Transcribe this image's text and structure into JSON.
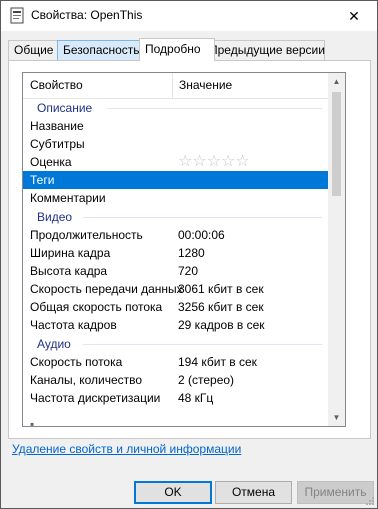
{
  "window": {
    "title": "Свойства: OpenThis",
    "close_glyph": "✕"
  },
  "tabs": [
    "Общие",
    "Безопасность",
    "Подробно",
    "Предыдущие версии"
  ],
  "list": {
    "header": {
      "property": "Свойство",
      "value": "Значение"
    },
    "groups": {
      "description": "Описание",
      "video": "Видео",
      "audio": "Аудио"
    },
    "description_rows": [
      {
        "k": "Название",
        "v": ""
      },
      {
        "k": "Субтитры",
        "v": ""
      },
      {
        "k": "Оценка",
        "v": ""
      },
      {
        "k": "Теги",
        "v": ""
      },
      {
        "k": "Комментарии",
        "v": ""
      }
    ],
    "rating": {
      "stars_total": 5,
      "stars_filled": 0,
      "glyph": "☆☆☆☆☆"
    },
    "video_rows": [
      {
        "k": "Продолжительность",
        "v": "00:00:06"
      },
      {
        "k": "Ширина кадра",
        "v": "1280"
      },
      {
        "k": "Высота кадра",
        "v": "720"
      },
      {
        "k": "Скорость передачи данных",
        "v": "3061 кбит в сек"
      },
      {
        "k": "Общая скорость потока",
        "v": "3256 кбит в сек"
      },
      {
        "k": "Частота кадров",
        "v": "29 кадров в сек"
      }
    ],
    "audio_rows": [
      {
        "k": "Скорость потока",
        "v": "194 кбит в сек"
      },
      {
        "k": "Каналы, количество",
        "v": "2 (стерео)"
      },
      {
        "k": "Частота дискретизации",
        "v": "48 кГц"
      }
    ],
    "selected_row": "Теги"
  },
  "remove_link": "Удаление свойств и личной информации",
  "buttons": {
    "ok": "OK",
    "cancel": "Отмена",
    "apply": "Применить"
  },
  "colors": {
    "selection": "#0078d7",
    "group_text": "#1e3287",
    "link": "#0066cc"
  }
}
